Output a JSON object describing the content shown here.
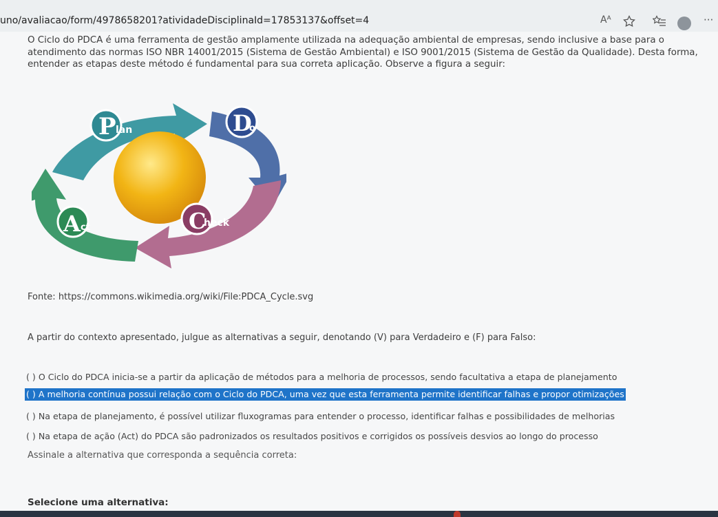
{
  "browser": {
    "url": "uno/avaliacao/form/4978658201?atividadeDisciplinaId=17853137&offset=4",
    "icons": [
      "read-aloud-icon",
      "favorite-star-icon",
      "favorites-list-icon",
      "profile-icon",
      "more-icon"
    ],
    "read_aloud_glyph": "Aᴬ",
    "more_glyph": "···"
  },
  "question": {
    "intro": "O Ciclo do PDCA é uma ferramenta de gestão amplamente utilizada na adequação ambiental de empresas, sendo inclusive a base para o atendimento das normas ISO NBR 14001/2015 (Sistema de Gestão Ambiental) e ISO 9001/2015 (Sistema de Gestão da Qualidade). Desta forma, entender as etapas deste método é fundamental para sua correta aplicação. Observe a figura a seguir:",
    "figure": {
      "plan_letter": "P",
      "plan_rest": "lan",
      "do_letter": "D",
      "do_rest": "o",
      "check_letter": "C",
      "check_rest": "heck",
      "act_letter": "A",
      "act_rest": "ct",
      "colors": {
        "plan": "#3f9aa3",
        "do": "#4f6fa8",
        "check": "#b26d90",
        "act": "#3f9a6c",
        "sphere": "#f2b515"
      }
    },
    "source": "Fonte: https://commons.wikimedia.org/wiki/File:PDCA_Cycle.svg",
    "context": "A partir do contexto apresentado, julgue as alternativas a seguir, denotando (V) para Verdadeiro e (F) para Falso:",
    "statements": [
      "( ) O Ciclo do PDCA inicia-se a partir da aplicação de métodos para a melhoria de processos, sendo facultativa a etapa de planejamento",
      "( ) A melhoria contínua possui relação com o Ciclo do PDCA, uma vez que esta ferramenta permite identificar falhas e propor otimizações",
      "( ) Na etapa de planejamento, é possível utilizar fluxogramas para entender o processo, identificar falhas e possibilidades de melhorias",
      "( ) Na etapa de ação (Act) do PDCA são padronizados os resultados positivos e corrigidos os possíveis desvios ao longo do processo"
    ],
    "prompt": "Assinale a alternativa que corresponda a sequência correta:",
    "select_label": "Selecione uma alternativa:"
  },
  "colors": {
    "highlight": "#1f74c9"
  }
}
